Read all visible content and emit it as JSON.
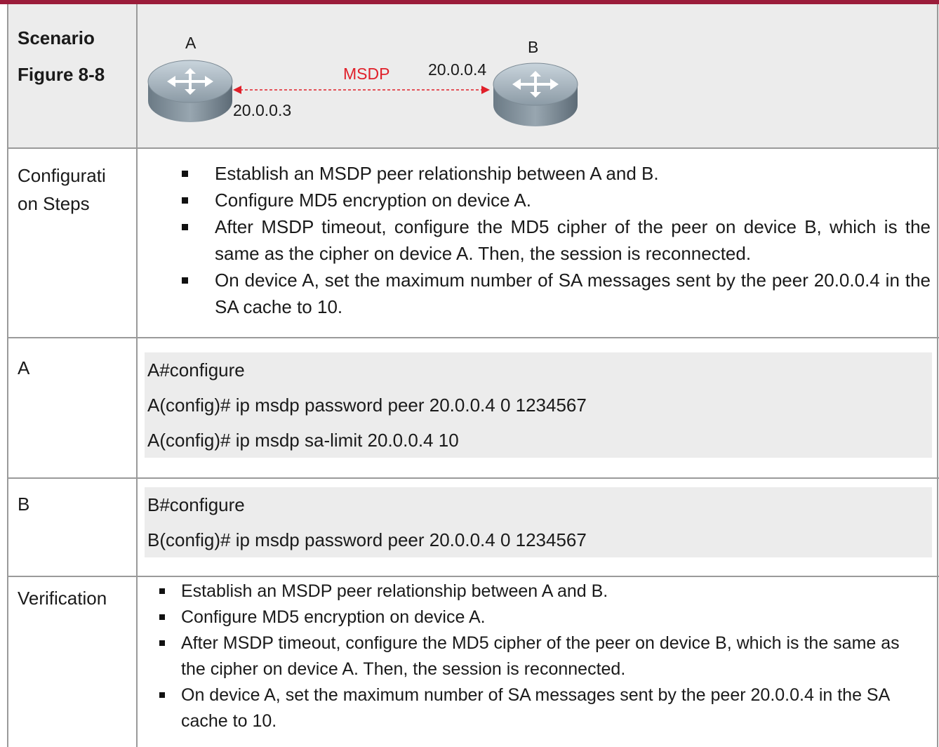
{
  "scenario": {
    "label1": "Scenario",
    "label2": "Figure 8-8",
    "device_a": "A",
    "device_b": "B",
    "link_label": "MSDP",
    "ip_a": "20.0.0.3",
    "ip_b": "20.0.0.4",
    "link_color": "#e0202a"
  },
  "config_steps": {
    "label": "Configurati\non Steps",
    "items": [
      "Establish an MSDP peer relationship between A and B.",
      "Configure MD5 encryption on device A.",
      "After MSDP timeout, configure the MD5 cipher of the peer on device B, which is the same as the cipher on device A. Then, the session is reconnected.",
      "On device A, set the maximum number of SA messages sent by the peer 20.0.0.4 in the SA cache to 10."
    ]
  },
  "device_a_cfg": {
    "label": "A",
    "lines": [
      "A#configure",
      "A(config)# ip msdp password peer 20.0.0.4 0 1234567",
      "A(config)# ip msdp sa-limit 20.0.0.4 10"
    ]
  },
  "device_b_cfg": {
    "label": "B",
    "lines": [
      "B#configure",
      "B(config)# ip msdp password peer 20.0.0.4 0 1234567"
    ]
  },
  "verification": {
    "label": "Verification",
    "items": [
      "Establish an MSDP peer relationship between A and B.",
      "Configure MD5 encryption on device A.",
      "After MSDP timeout, configure the MD5 cipher of the peer on device B, which is the same as the cipher on device A. Then, the session is reconnected.",
      "On device A, set the maximum number of SA messages sent by the peer 20.0.0.4 in the SA cache to 10."
    ]
  }
}
